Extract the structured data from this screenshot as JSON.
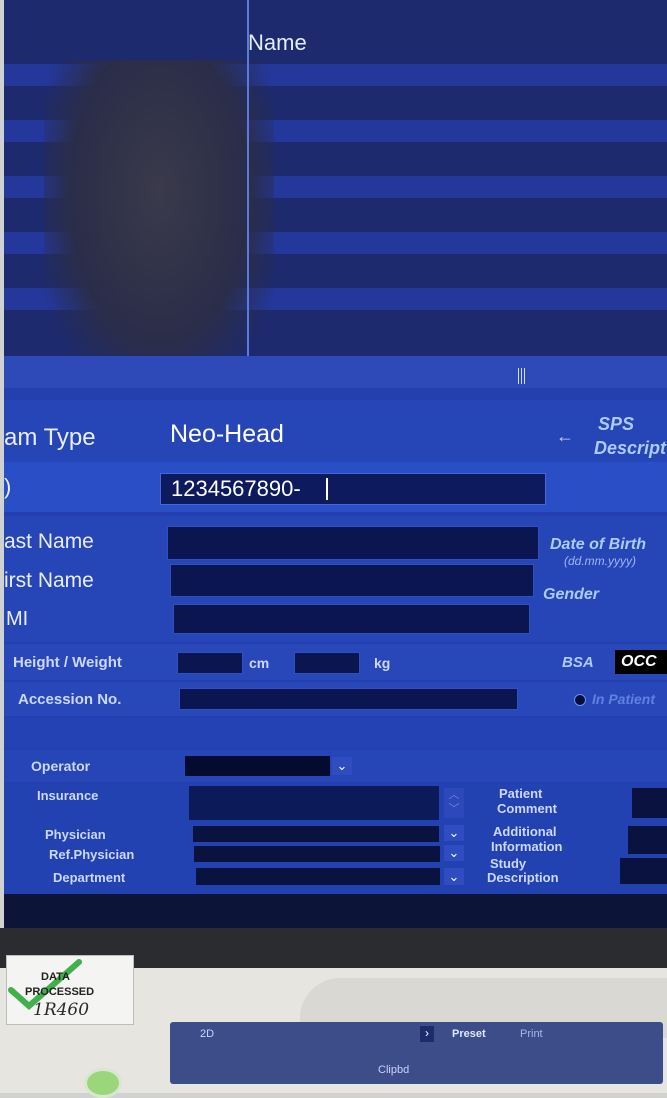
{
  "list": {
    "column_header": "Name"
  },
  "exam": {
    "exam_type_label": "am Type",
    "exam_type_value": "Neo-Head",
    "sps_label": "SPS",
    "description_label": "Descript",
    "arrow": "←"
  },
  "patient": {
    "id_label": ")",
    "id_value": "1234567890-",
    "last_name_label": "ast Name",
    "first_name_label": "irst Name",
    "mi_label": "MI",
    "dob_label": "Date of Birth",
    "dob_format": "(dd.mm.yyyy)",
    "gender_label": "Gender",
    "height_weight_label": "Height / Weight",
    "height_unit": "cm",
    "weight_unit": "kg",
    "bsa_label": "BSA",
    "bsa_value": "OCC",
    "accession_label": "Accession No.",
    "in_patient_label": "In Patient"
  },
  "staff": {
    "operator_label": "Operator",
    "insurance_label": "Insurance",
    "physician_label": "Physician",
    "ref_physician_label": "Ref.Physician",
    "department_label": "Department",
    "patient_comment_label_1": "Patient",
    "patient_comment_label_2": "Comment",
    "additional_info_label_1": "Additional",
    "additional_info_label_2": "Information",
    "study_desc_label_1": "Study",
    "study_desc_label_2": "Description"
  },
  "sticker": {
    "line1": "DATA",
    "line2": "PROCESSED",
    "handwritten": "1R460"
  },
  "keypad": {
    "key_2d": "2D",
    "key_preset": "Preset",
    "key_print": "Print",
    "key_clipboard": "Clipbd"
  },
  "colors": {
    "panel_bg": "#243fb0",
    "field_bg": "#0b1650",
    "label_text": "#e9eeff",
    "accent_italic": "#aecbff"
  }
}
